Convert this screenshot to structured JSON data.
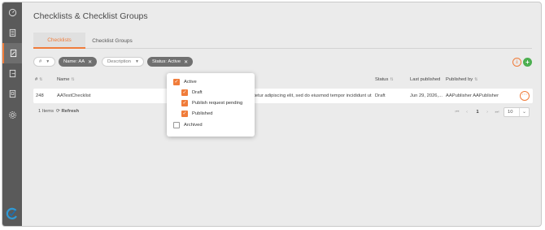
{
  "page": {
    "title": "Checklists & Checklist Groups"
  },
  "tabs": [
    {
      "label": "Checklists",
      "active": true
    },
    {
      "label": "Checklist Groups",
      "active": false
    }
  ],
  "filters": {
    "id_chip": "#",
    "name_chip": "Name: AA",
    "description_chip": "Description",
    "status_chip": "Status: Active"
  },
  "table": {
    "headers": {
      "id": "#",
      "name": "Name",
      "status": "Status",
      "last_published": "Last published",
      "published_by": "Published by"
    },
    "rows": [
      {
        "id": "248",
        "name": "AATestChecklist",
        "description": "t, consectetur adipiscing elit, sed do eiusmod tempor incididunt ut labor...",
        "status": "Draft",
        "last_published": "Jun 29, 2026,...",
        "published_by": "AAPublisher AAPublisher"
      }
    ]
  },
  "footer": {
    "items_count": "1 Items",
    "refresh": "Refresh",
    "current_page": "1",
    "page_size": "10"
  },
  "status_dropdown": {
    "options": [
      {
        "label": "Active",
        "checked": true
      },
      {
        "label": "Draft",
        "checked": true
      },
      {
        "label": "Publish request pending",
        "checked": true
      },
      {
        "label": "Published",
        "checked": true
      },
      {
        "label": "Archived",
        "checked": false
      }
    ]
  },
  "colors": {
    "accent": "#f07c3a",
    "sidebar": "#5a5a5a",
    "add_button": "#4caf50"
  }
}
